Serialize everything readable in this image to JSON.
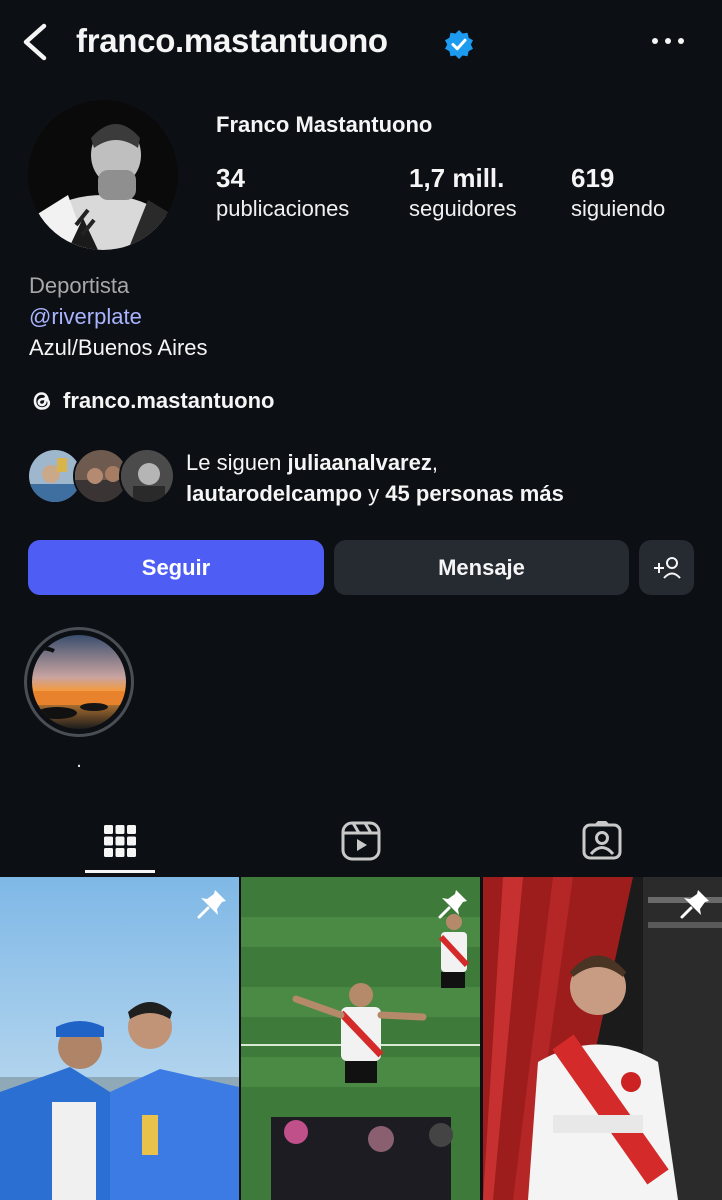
{
  "header": {
    "username": "franco.mastantuono",
    "verified": true
  },
  "profile": {
    "full_name": "Franco Mastantuono",
    "stats": [
      {
        "value": "34",
        "label": "publicaciones"
      },
      {
        "value": "1,7 mill.",
        "label": "seguidores"
      },
      {
        "value": "619",
        "label": "siguiendo"
      }
    ],
    "category": "Deportista",
    "mention": "@riverplate",
    "location": "Azul/Buenos Aires",
    "threads_handle": "franco.mastantuono"
  },
  "followed_by": {
    "prefix": "Le siguen",
    "user1": "juliaanalvarez",
    "separator": ",",
    "user2": "lautarodelcampo",
    "connector": "y",
    "others": "45 personas más"
  },
  "actions": {
    "follow_label": "Seguir",
    "message_label": "Mensaje"
  },
  "highlights": [
    {
      "label": "."
    }
  ],
  "tabs": [
    {
      "icon": "grid-icon",
      "active": true
    },
    {
      "icon": "reels-icon",
      "active": false
    },
    {
      "icon": "tagged-icon",
      "active": false
    }
  ],
  "posts": [
    {
      "pinned": true
    },
    {
      "pinned": true
    },
    {
      "pinned": true
    }
  ],
  "colors": {
    "background": "#0c0f14",
    "accent": "#4e5ef5",
    "secondary_button": "#262a31",
    "verified": "#1d9bf0",
    "mention": "#a9b4ff"
  }
}
